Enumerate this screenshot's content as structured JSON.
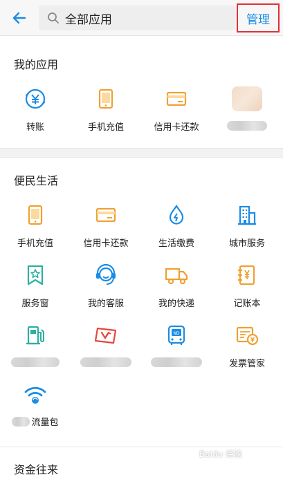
{
  "header": {
    "back_icon": "arrow-left-icon",
    "search_icon": "search-icon",
    "search_text": "全部应用",
    "manage_label": "管理"
  },
  "sections": {
    "my_apps": {
      "title": "我的应用",
      "items": [
        {
          "label": "转账",
          "icon": "transfer-icon"
        },
        {
          "label": "手机充值",
          "icon": "phone-topup-icon"
        },
        {
          "label": "信用卡还款",
          "icon": "credit-card-icon"
        }
      ]
    },
    "life": {
      "title": "便民生活",
      "items": [
        {
          "label": "手机充值",
          "icon": "phone-topup-icon"
        },
        {
          "label": "信用卡还款",
          "icon": "credit-card-icon"
        },
        {
          "label": "生活缴费",
          "icon": "utility-drop-icon"
        },
        {
          "label": "城市服务",
          "icon": "city-building-icon"
        },
        {
          "label": "服务窗",
          "icon": "service-window-icon"
        },
        {
          "label": "我的客服",
          "icon": "customer-service-icon"
        },
        {
          "label": "我的快递",
          "icon": "delivery-truck-icon"
        },
        {
          "label": "记账本",
          "icon": "ledger-icon"
        },
        {
          "label": "发票管家",
          "icon": "invoice-icon"
        },
        {
          "label": "流量包",
          "icon": "wifi-data-icon"
        }
      ]
    },
    "funds": {
      "title": "资金往来"
    }
  },
  "colors": {
    "accent_blue": "#1a8ce6",
    "icon_orange": "#f0a030",
    "icon_teal": "#2bb0a0",
    "icon_red": "#e8453c",
    "highlight_red": "#e0303a"
  },
  "watermark": "Baidu 经验"
}
